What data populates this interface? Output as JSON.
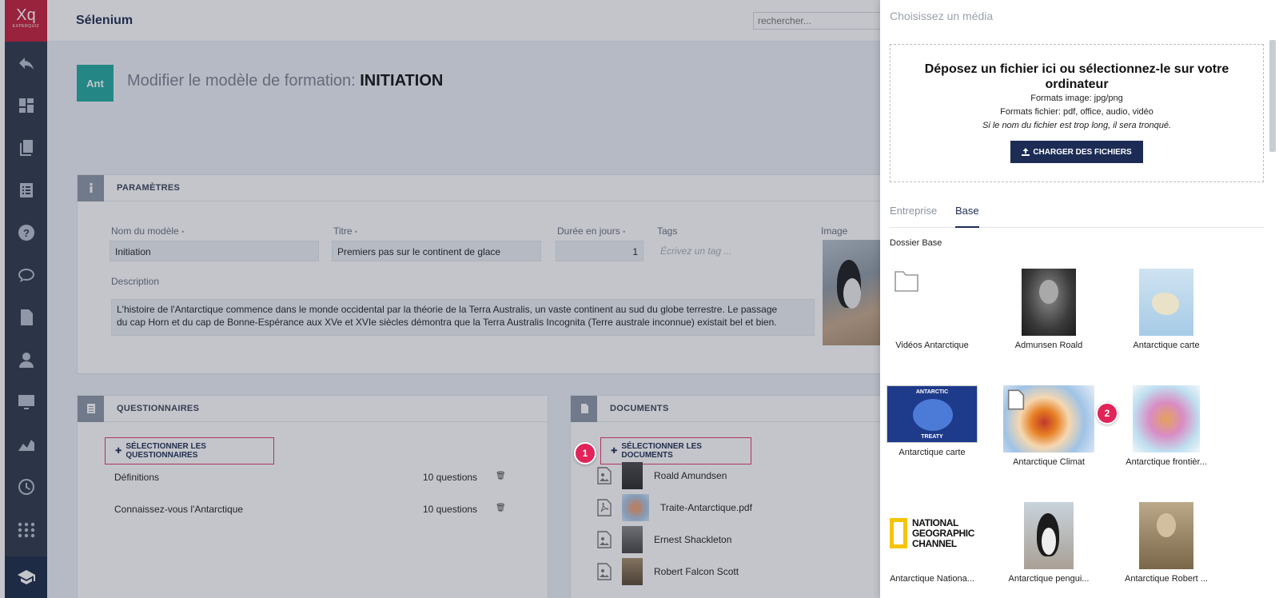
{
  "logo": {
    "big": "Xq",
    "small": "EXPERQUIZ"
  },
  "sidebar_icons": [
    "back-icon",
    "dashboard-icon",
    "copy-icon",
    "list-icon",
    "help-icon",
    "chat-icon",
    "file-icon",
    "user-icon",
    "monitor-icon",
    "chart-icon",
    "clock-icon",
    "apps-icon",
    "graduation-cap-icon"
  ],
  "header": {
    "app_title": "Sélenium",
    "search_placeholder": "rechercher..."
  },
  "page": {
    "avatar": "Ant",
    "title_prefix": "Modifier le modèle de formation: ",
    "title_name": "INITIATION"
  },
  "params": {
    "title": "PARAMÈTRES",
    "name_label": "Nom du modèle",
    "name_value": "Initiation",
    "titre_label": "Titre",
    "titre_value": "Premiers pas sur le continent de glace",
    "duree_label": "Durée en jours",
    "duree_value": "1",
    "tags_label": "Tags",
    "tags_placeholder": "Écrivez un tag ...",
    "image_label": "Image",
    "description_label": "Description",
    "description_value": "L'histoire de l'Antarctique commence dans le monde occidental par la théorie de la Terra Australis, un vaste continent au sud du globe terrestre. Le passage du cap Horn et du cap de Bonne-Espérance aux XVe et XVIe siècles démontra que la Terra Australis Incognita (Terre australe inconnue) existait bel et bien."
  },
  "questionnaires": {
    "title": "QUESTIONNAIRES",
    "select_label": "SÉLECTIONNER LES QUESTIONNAIRES",
    "items": [
      {
        "name": "Définitions",
        "count": "10 questions"
      },
      {
        "name": "Connaissez-vous l'Antarctique",
        "count": "10 questions"
      }
    ]
  },
  "documents": {
    "title": "DOCUMENTS",
    "select_label": "SÉLECTIONNER LES DOCUMENTS",
    "items": [
      {
        "name": "Roald Amundsen",
        "type": "image"
      },
      {
        "name": "Traite-Antarctique.pdf",
        "type": "pdf"
      },
      {
        "name": "Ernest Shackleton",
        "type": "image"
      },
      {
        "name": "Robert Falcon Scott",
        "type": "image"
      }
    ]
  },
  "badges": {
    "one": "1",
    "two": "2"
  },
  "drawer": {
    "title": "Choisissez un média",
    "dropzone_title": "Déposez un fichier ici ou sélectionnez-le sur votre ordinateur",
    "formats_image": "Formats image: jpg/png",
    "formats_file": "Formats fichier: pdf, office, audio, vidéo",
    "truncate_note": "Si le nom du fichier est trop long, il sera tronqué.",
    "upload_label": "CHARGER DES FICHIERS",
    "tabs": [
      "Entreprise",
      "Base"
    ],
    "active_tab": "Base",
    "folder_label": "Dossier Base",
    "media": [
      {
        "label": "Vidéos Antarctique",
        "kind": "folder"
      },
      {
        "label": "Admunsen Roald",
        "kind": "portrait"
      },
      {
        "label": "Antarctique carte",
        "kind": "map"
      },
      {
        "label": "Antarctique carte",
        "kind": "flags"
      },
      {
        "label": "Antarctique Climat",
        "kind": "climate"
      },
      {
        "label": "Antarctique frontièr...",
        "kind": "borders"
      },
      {
        "label": "Antarctique Nationa...",
        "kind": "natgeo"
      },
      {
        "label": "Antarctique pengui...",
        "kind": "penguin"
      },
      {
        "label": "Antarctique Robert ...",
        "kind": "portrait-sepia"
      }
    ],
    "natgeo_text": [
      "NATIONAL",
      "GEOGRAPHIC",
      "CHANNEL"
    ],
    "flags_text": [
      "ANTARCTIC",
      "TREATY"
    ]
  },
  "colors": {
    "brand": "#c51e3a",
    "sidebar": "#2f3848",
    "accent": "#1d2c55",
    "teal": "#23a99f",
    "highlight": "#e12459"
  }
}
